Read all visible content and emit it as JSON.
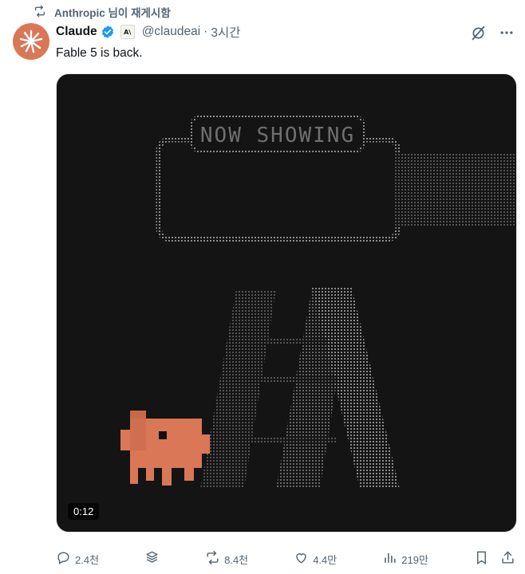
{
  "repost": {
    "text": "Anthropic 님이 재게시함"
  },
  "author": {
    "name": "Claude",
    "handle": "@claudeai",
    "separator": "·",
    "time": "3시간",
    "affiliation_badge": "A\\"
  },
  "tweet": {
    "text": "Fable 5 is back."
  },
  "media": {
    "sign_text": "NOW SHOWING",
    "duration": "0:12"
  },
  "actions": {
    "replies": "2.4천",
    "reposts": "8.4천",
    "likes": "4.4만",
    "views": "219만"
  },
  "colors": {
    "brand": "#d97757",
    "verified": "#1d9bf0",
    "muted": "#536471",
    "media_bg": "#141414"
  },
  "icons": [
    "repost-icon",
    "verified-icon",
    "grok-icon",
    "more-icon",
    "reply-icon",
    "layers-icon",
    "like-icon",
    "views-icon",
    "bookmark-icon",
    "share-icon"
  ]
}
